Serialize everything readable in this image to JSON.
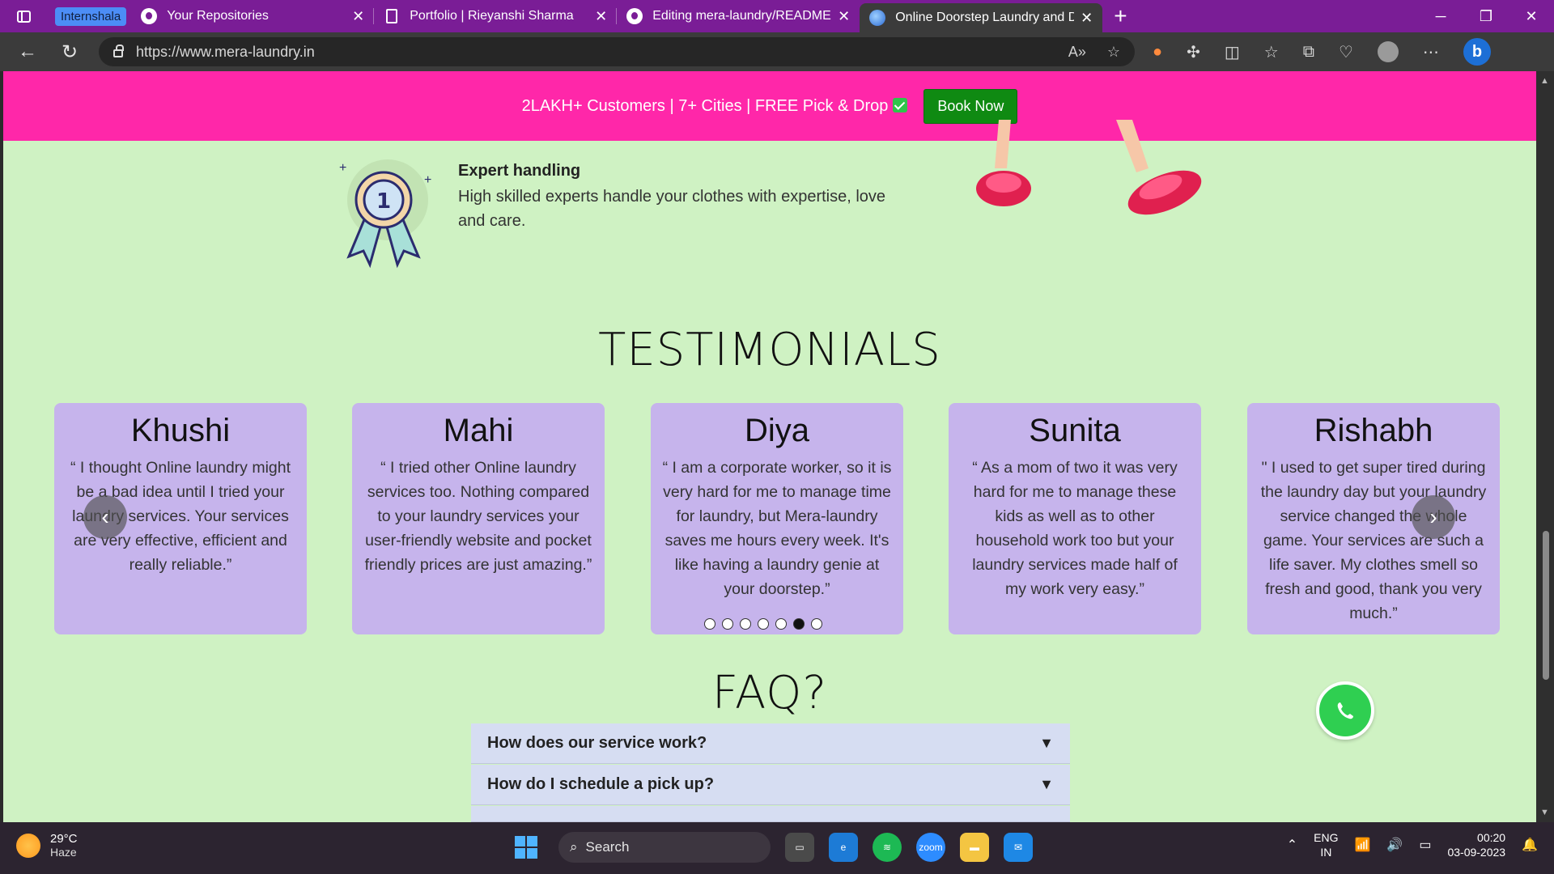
{
  "browser": {
    "tab_group": "Internshala",
    "tabs": [
      {
        "title": "Your Repositories",
        "icon": "github-icon"
      },
      {
        "title": "Portfolio | Rieyanshi Sharma",
        "icon": "document-icon"
      },
      {
        "title": "Editing mera-laundry/README.m",
        "icon": "github-icon"
      },
      {
        "title": "Online Doorstep Laundry and Dr",
        "icon": "globe-icon",
        "active": true
      }
    ],
    "url": "https://www.mera-laundry.in"
  },
  "promo": {
    "text": "2LAKH+ Customers | 7+ Cities | FREE Pick & Drop",
    "button": "Book Now",
    "bg_color": "#ff27a9",
    "button_color": "#0f8a12"
  },
  "feature": {
    "title": "Expert handling",
    "text": "High skilled experts handle your clothes with expertise, love and care.",
    "medal_number": "1"
  },
  "testimonials": {
    "heading": "TESTIMONIALS",
    "cards": [
      {
        "name": "Khushi",
        "quote": "“ I thought Online laundry might be a bad idea until I tried your laundry services. Your services are very effective, efficient and really reliable.”"
      },
      {
        "name": "Mahi",
        "quote": "“ I tried other Online laundry services too. Nothing compared to your laundry services your user-friendly website and pocket friendly prices are just amazing.”"
      },
      {
        "name": "Diya",
        "quote": "“ I am a corporate worker, so it is very hard for me to manage time for laundry, but Mera-laundry saves me hours every week. It's like having a laundry genie at your doorstep.”"
      },
      {
        "name": "Sunita",
        "quote": "“ As a mom of two it was very hard for me to manage these kids as well as to other household work too but your laundry services made half of my work very easy.”"
      },
      {
        "name": "Rishabh",
        "quote": "\" I used to get super tired during the laundry day but your laundry service changed the whole game. Your services are such a life saver. My clothes smell so fresh and good, thank you very much.”"
      }
    ],
    "dots_total": 7,
    "active_dot": 6,
    "card_color": "#c6b4ec"
  },
  "faq": {
    "heading": "FAQ?",
    "items": [
      {
        "q": "How does our service work?",
        "caret": "▼"
      },
      {
        "q": "How do I schedule a pick up?",
        "caret": "▼"
      }
    ]
  },
  "taskbar": {
    "temp": "29°C",
    "weather": "Haze",
    "search": "Search",
    "lang1": "ENG",
    "lang2": "IN",
    "time": "00:20",
    "date": "03-09-2023"
  }
}
